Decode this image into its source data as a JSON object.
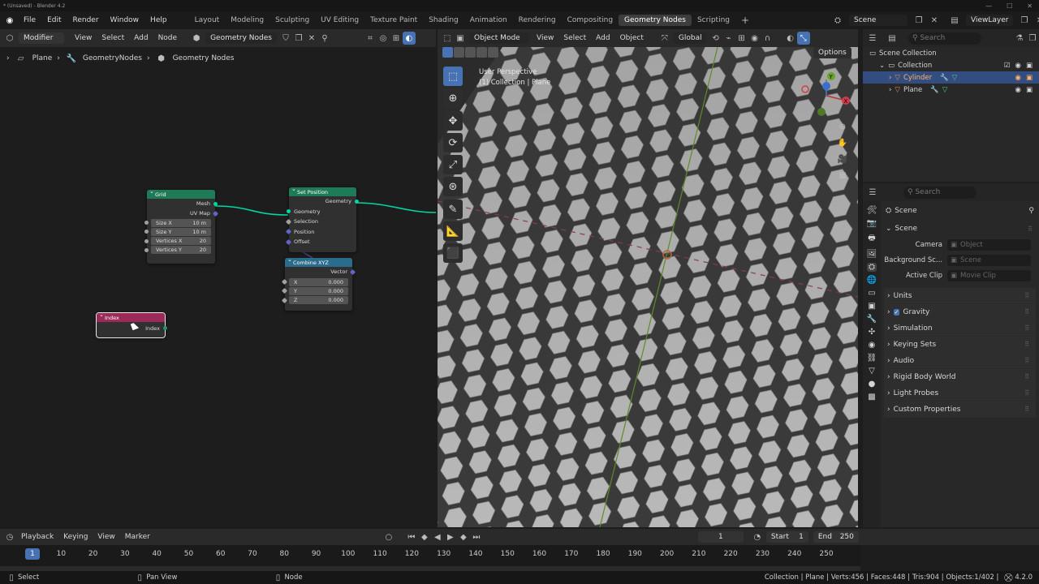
{
  "titlebar": {
    "title": "* (Unsaved) - Blender 4.2"
  },
  "menus": [
    "File",
    "Edit",
    "Render",
    "Window",
    "Help"
  ],
  "workspaces": [
    "Layout",
    "Modeling",
    "Sculpting",
    "UV Editing",
    "Texture Paint",
    "Shading",
    "Animation",
    "Rendering",
    "Compositing",
    "Geometry Nodes",
    "Scripting"
  ],
  "active_workspace": "Geometry Nodes",
  "scene": {
    "name": "Scene",
    "view_layer": "ViewLayer"
  },
  "node_editor": {
    "header": {
      "type": "Modifier",
      "menus": [
        "View",
        "Select",
        "Add",
        "Node"
      ],
      "tree": "Geometry Nodes"
    },
    "breadcrumb": [
      "Plane",
      "GeometryNodes",
      "Geometry Nodes"
    ],
    "nodes": {
      "grid": {
        "title": "Grid",
        "out_mesh": "Mesh",
        "out_uv": "UV Map",
        "fields": [
          {
            "label": "Size X",
            "value": "10 m"
          },
          {
            "label": "Size Y",
            "value": "10 m"
          },
          {
            "label": "Vertices X",
            "value": "20"
          },
          {
            "label": "Vertices Y",
            "value": "20"
          }
        ]
      },
      "set_position": {
        "title": "Set Position",
        "out": "Geometry",
        "inputs": [
          "Geometry",
          "Selection",
          "Position",
          "Offset"
        ]
      },
      "combine_xyz": {
        "title": "Combine XYZ",
        "out": "Vector",
        "fields": [
          {
            "label": "X",
            "value": "0.000"
          },
          {
            "label": "Y",
            "value": "0.000"
          },
          {
            "label": "Z",
            "value": "0.000"
          }
        ]
      },
      "index": {
        "title": "Index",
        "out": "Index"
      }
    }
  },
  "viewport": {
    "header": {
      "mode": "Object Mode",
      "menus": [
        "View",
        "Select",
        "Add",
        "Object"
      ],
      "orientation": "Global",
      "options": "Options"
    },
    "overlay_text": [
      "User Perspective",
      "(1) Collection | Plane"
    ]
  },
  "outliner": {
    "search_placeholder": "Search",
    "items": [
      {
        "name": "Scene Collection",
        "depth": 0
      },
      {
        "name": "Collection",
        "depth": 1
      },
      {
        "name": "Cylinder",
        "depth": 2,
        "selected": true
      },
      {
        "name": "Plane",
        "depth": 2,
        "selected": false
      }
    ]
  },
  "properties": {
    "search_placeholder": "Search",
    "context": "Scene",
    "section": "Scene",
    "fields": [
      {
        "label": "Camera",
        "placeholder": "Object"
      },
      {
        "label": "Background Sc...",
        "placeholder": "Scene"
      },
      {
        "label": "Active Clip",
        "placeholder": "Movie Clip"
      }
    ],
    "panels": [
      "Units",
      "Gravity",
      "Simulation",
      "Keying Sets",
      "Audio",
      "Rigid Body World",
      "Light Probes",
      "Custom Properties"
    ]
  },
  "timeline": {
    "menus": [
      "Playback",
      "Keying",
      "View",
      "Marker"
    ],
    "current_frame": "1",
    "start_label": "Start",
    "start": "1",
    "end_label": "End",
    "end": "250",
    "ticks": [
      "1",
      "10",
      "20",
      "30",
      "40",
      "50",
      "60",
      "70",
      "80",
      "90",
      "100",
      "110",
      "120",
      "130",
      "140",
      "150",
      "160",
      "170",
      "180",
      "190",
      "200",
      "210",
      "220",
      "230",
      "240",
      "250"
    ]
  },
  "statusbar": {
    "left": [
      "Select",
      "Pan View",
      "Node"
    ],
    "right": "Collection | Plane | Verts:456 | Faces:448 | Tris:904 | Objects:1/402 |",
    "version": "4.2.0"
  },
  "colors": {
    "grid_header": "#1f7a57",
    "setpos_header": "#1f7a57",
    "combine_header": "#2b6b8c",
    "index_header": "#9b2a58",
    "geometry_socket": "#00d6a3",
    "vector_socket": "#6363c7",
    "float_socket": "#a1a1a1",
    "accent": "#4772b3"
  }
}
